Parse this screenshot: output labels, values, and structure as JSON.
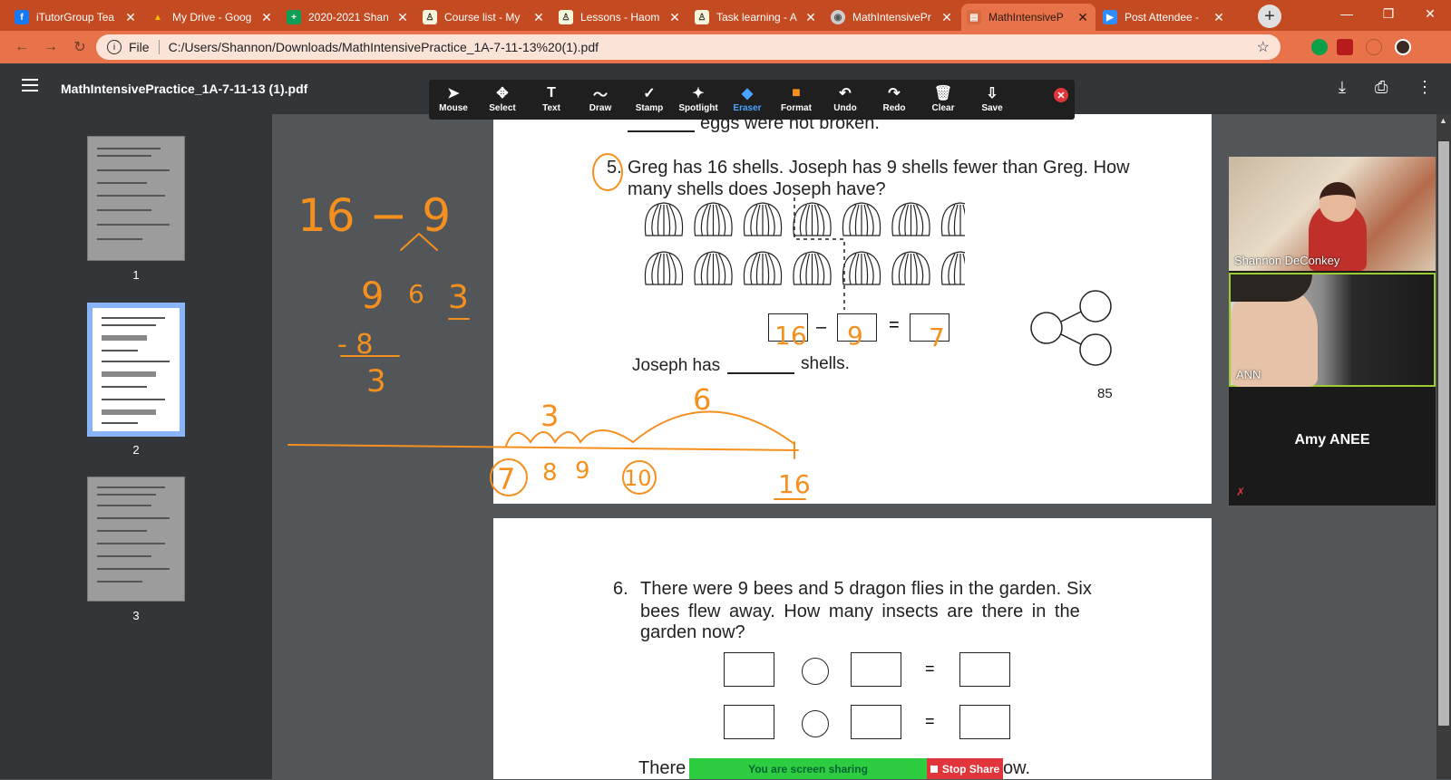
{
  "tabs": [
    {
      "title": "iTutorGroup Tea",
      "icon": "facebook-icon",
      "color": "#1877f2"
    },
    {
      "title": "My Drive - Goog",
      "icon": "drive-icon",
      "color": "#fbbc04"
    },
    {
      "title": "2020-2021 Shan",
      "icon": "sheets-icon",
      "color": "#0f9d58"
    },
    {
      "title": "Course list - My",
      "icon": "course-icon",
      "color": "#f5f5dc"
    },
    {
      "title": "Lessons - Haom",
      "icon": "lessons-icon",
      "color": "#f5f5dc"
    },
    {
      "title": "Task learning - A",
      "icon": "task-icon",
      "color": "#f5f5dc"
    },
    {
      "title": "MathIntensivePr",
      "icon": "globe-icon",
      "color": "#cccccc"
    },
    {
      "title": "MathIntensiveP",
      "icon": "pdf-tab-icon",
      "color": "#e8734a"
    },
    {
      "title": "Post Attendee -",
      "icon": "zoom-icon",
      "color": "#2d8cff"
    }
  ],
  "address": {
    "file_label": "File",
    "url": "C:/Users/Shannon/Downloads/MathIntensivePractice_1A-7-11-13%20(1).pdf"
  },
  "pdf": {
    "title": "MathIntensivePractice_1A-7-11-13 (1).pdf",
    "thumbnails": [
      "1",
      "2",
      "3"
    ]
  },
  "annotation_tools": [
    {
      "label": "Mouse",
      "icon": "cursor-icon",
      "glyph": "➤"
    },
    {
      "label": "Select",
      "icon": "move-icon",
      "glyph": "✥"
    },
    {
      "label": "Text",
      "icon": "text-icon",
      "glyph": "T"
    },
    {
      "label": "Draw",
      "icon": "draw-icon",
      "glyph": "〜"
    },
    {
      "label": "Stamp",
      "icon": "stamp-icon",
      "glyph": "✓"
    },
    {
      "label": "Spotlight",
      "icon": "spotlight-icon",
      "glyph": "✦"
    },
    {
      "label": "Eraser",
      "icon": "eraser-icon",
      "glyph": "◆"
    },
    {
      "label": "Format",
      "icon": "format-icon",
      "glyph": "■"
    },
    {
      "label": "Undo",
      "icon": "undo-icon",
      "glyph": "↶"
    },
    {
      "label": "Redo",
      "icon": "redo-icon",
      "glyph": "↷"
    },
    {
      "label": "Clear",
      "icon": "trash-icon",
      "glyph": "🗑"
    },
    {
      "label": "Save",
      "icon": "save-icon",
      "glyph": "⇩"
    }
  ],
  "page1": {
    "top_text": "eggs were not broken.",
    "q5_num": "5.",
    "q5_line1": "Greg has 16 shells. Joseph has 9 shells fewer than Greg. How",
    "q5_line2": "many shells does Joseph have?",
    "minus": "–",
    "equals": "=",
    "answer_prefix": "Joseph has",
    "answer_suffix": "shells.",
    "page_number": "85"
  },
  "page2": {
    "q6_num": "6.",
    "q6_line1": "There were 9 bees and 5 dragon flies in the garden. Six",
    "q6_line2": "bees flew away. How many insects are there in the",
    "q6_line3": "garden now?",
    "equals": "=",
    "bottom_left": "There",
    "bottom_right": "ow."
  },
  "handwriting": {
    "big_eq": "16 − 9",
    "nine": "9",
    "six": "6",
    "three": "3",
    "minus_eight": "- 8",
    "result_three": "3",
    "box1": "16",
    "box2": "9",
    "box3": "7",
    "arc_small": "3",
    "arc_big": "6",
    "nl_7": "7",
    "nl_8": "8",
    "nl_9": "9",
    "nl_10": "10",
    "nl_16": "16"
  },
  "participants": {
    "video1_name": "Shannon DeConkey",
    "video2_name": "ANN",
    "namecard": "Amy ANEE"
  },
  "share": {
    "status": "You are screen sharing",
    "stop": "Stop Share"
  },
  "colors": {
    "accent_orange": "#f5901e",
    "tabbar": "#c44a21"
  }
}
